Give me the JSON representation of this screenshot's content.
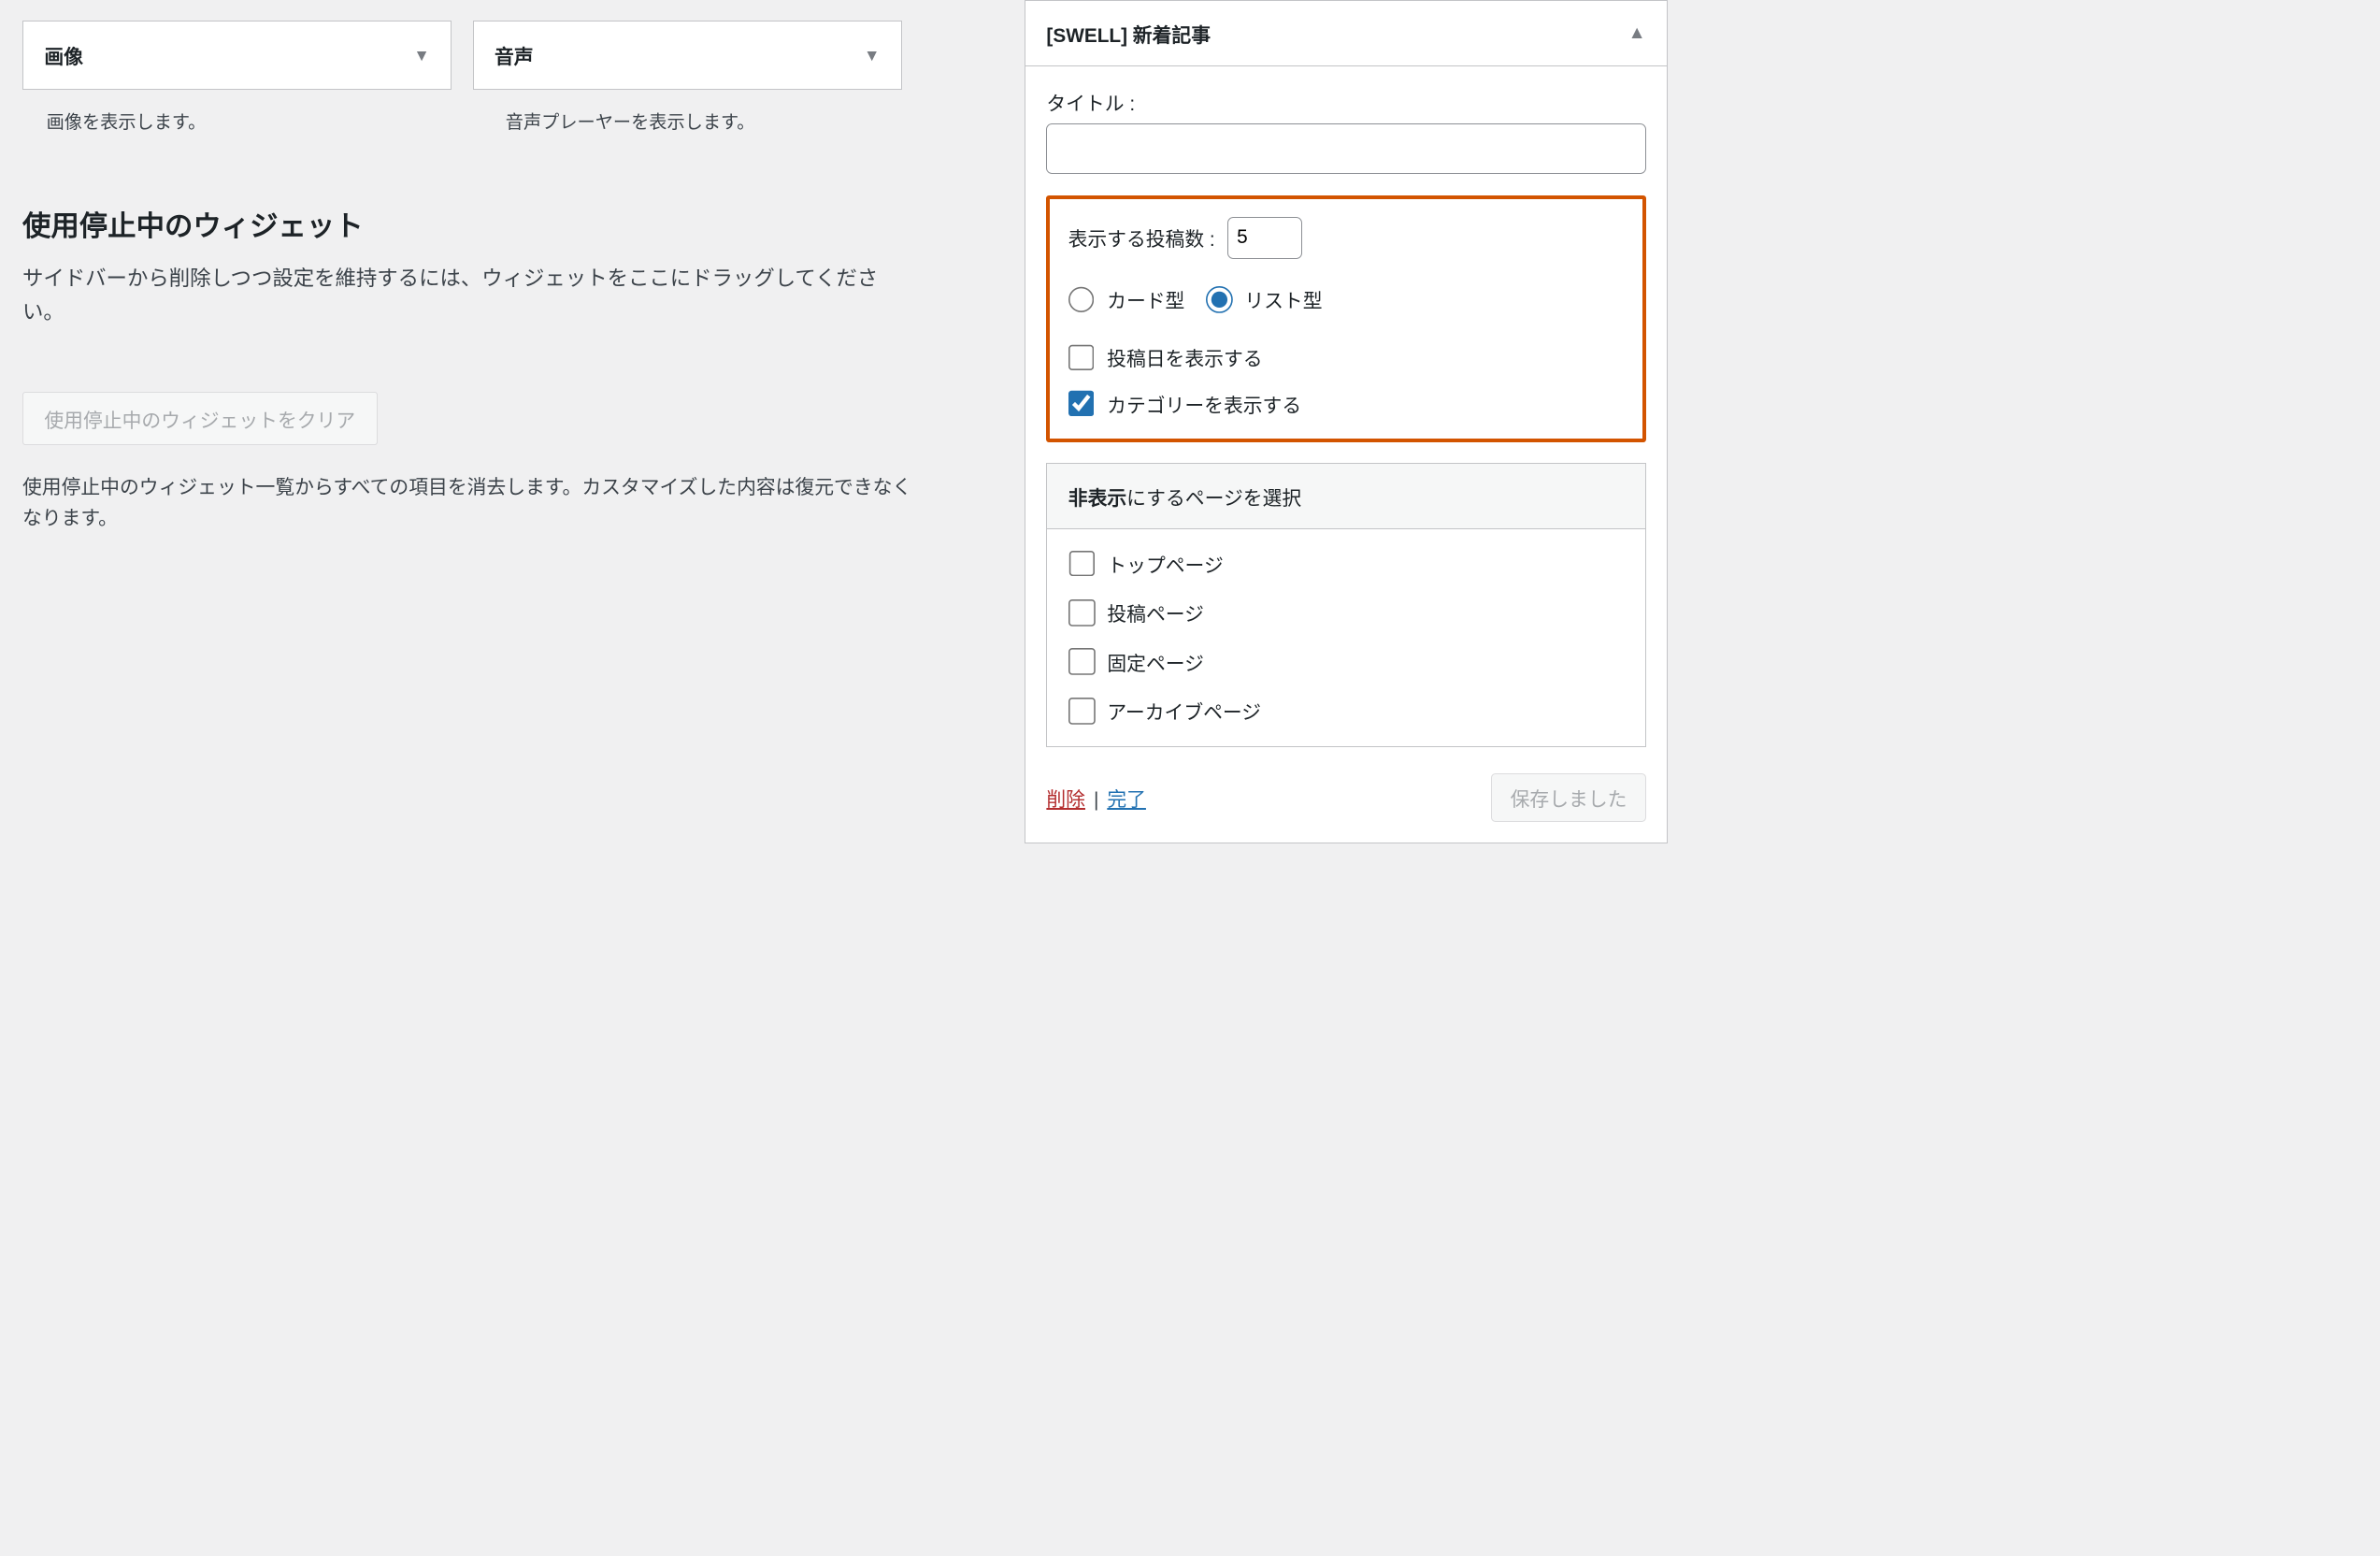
{
  "left": {
    "widgets": [
      {
        "title": "画像",
        "desc": "画像を表示します。"
      },
      {
        "title": "音声",
        "desc": "音声プレーヤーを表示します。"
      }
    ],
    "inactive_heading": "使用停止中のウィジェット",
    "inactive_desc": "サイドバーから削除しつつ設定を維持するには、ウィジェットをここにドラッグしてください。",
    "clear_button": "使用停止中のウィジェットをクリア",
    "clear_desc": "使用停止中のウィジェット一覧からすべての項目を消去します。カスタマイズした内容は復元できなくなります。"
  },
  "panel": {
    "title": "[SWELL] 新着記事",
    "title_label": "タイトル :",
    "title_value": "",
    "count_label": "表示する投稿数 :",
    "count_value": "5",
    "layout_card": "カード型",
    "layout_list": "リスト型",
    "show_date": "投稿日を表示する",
    "show_category": "カテゴリーを表示する",
    "hide_section_bold": "非表示",
    "hide_section_rest": "にするページを選択",
    "hide_pages": [
      "トップページ",
      "投稿ページ",
      "固定ページ",
      "アーカイブページ"
    ],
    "delete": "削除",
    "done": "完了",
    "saved": "保存しました"
  }
}
